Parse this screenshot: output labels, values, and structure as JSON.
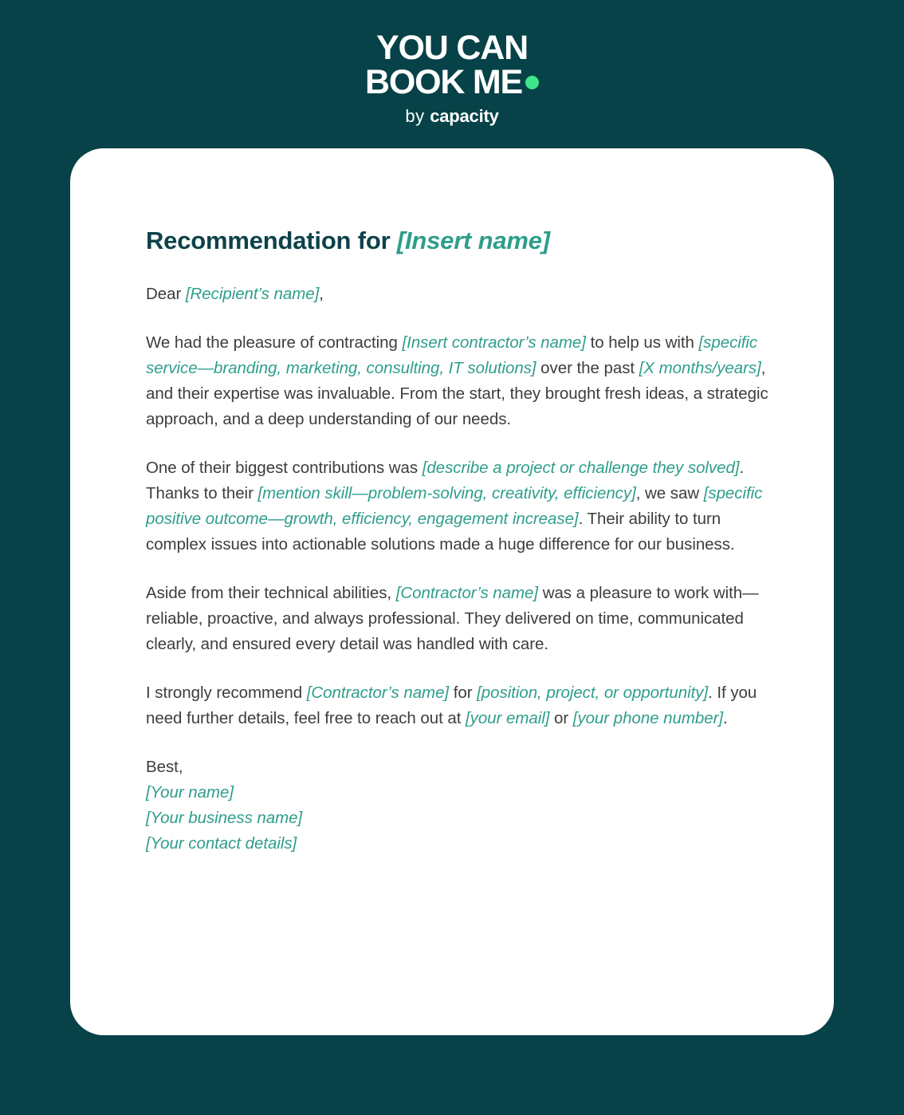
{
  "brand": {
    "logo_line_1": "YOU CAN",
    "logo_line_2": "BOOK ME",
    "logo_dot": "green-dot",
    "tagline_prefix": "by ",
    "tagline_brand": "capacity",
    "colors": {
      "background": "#064248",
      "card": "#ffffff",
      "accent_green": "#3CE88A",
      "accent_teal": "#2E9E8B",
      "heading": "#0D4249",
      "body_text": "#3D3D3D"
    }
  },
  "letter": {
    "title_static": "Recommendation for ",
    "title_placeholder": "[Insert name]",
    "salutation": {
      "static_1": "Dear ",
      "placeholder_1": "[Recipient’s name]",
      "static_2": ","
    },
    "paragraph_1": {
      "static_1": "We had the pleasure of contracting ",
      "placeholder_1": "[Insert contractor’s name]",
      "static_2": " to help us with ",
      "placeholder_2": "[specific service—branding, marketing, consulting, IT solutions]",
      "static_3": " over the past ",
      "placeholder_3": "[X months/years]",
      "static_4": ", and their expertise was invaluable. From the start, they brought fresh ideas, a strategic approach, and a deep understanding of our needs."
    },
    "paragraph_2": {
      "static_1": "One of their biggest contributions was ",
      "placeholder_1": "[describe a project or challenge they solved]",
      "static_2": ". Thanks to their ",
      "placeholder_2": "[mention skill—problem-solving, creativity, efficiency]",
      "static_3": ", we saw ",
      "placeholder_3": "[specific positive outcome—growth, efficiency, engagement increase]",
      "static_4": ". Their ability to turn complex issues into actionable solutions made a huge difference for our business."
    },
    "paragraph_3": {
      "static_1": "Aside from their technical abilities, ",
      "placeholder_1": "[Contractor’s name]",
      "static_2": " was a pleasure to work with—reliable, proactive, and always professional. They delivered on time, communicated clearly, and ensured every detail was handled with care."
    },
    "paragraph_4": {
      "static_1": "I strongly recommend ",
      "placeholder_1": "[Contractor’s name]",
      "static_2": " for ",
      "placeholder_2": "[position, project, or opportunity]",
      "static_3": ". If you need further details, feel free to reach out at ",
      "placeholder_3": "[your email]",
      "static_4": " or ",
      "placeholder_4": "[your phone number]",
      "static_5": "."
    },
    "signature": {
      "closing": "Best,",
      "placeholder_1": "[Your name]",
      "placeholder_2": "[Your business name]",
      "placeholder_3": "[Your contact details]"
    }
  }
}
